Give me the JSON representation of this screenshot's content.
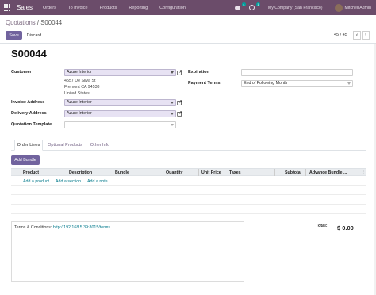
{
  "navbar": {
    "brand": "Sales",
    "menu": [
      "Orders",
      "To Invoice",
      "Products",
      "Reporting",
      "Configuration"
    ],
    "messages_badge": "4",
    "activities_badge": "1",
    "company": "My Company (San Francisco)",
    "user": "Mitchell Admin"
  },
  "breadcrumb": {
    "parent": "Quotations",
    "separator": "/",
    "current": "S00044"
  },
  "buttons": {
    "save": "Save",
    "discard": "Discard",
    "add_bundle": "Add Bundle"
  },
  "pager": {
    "value": "45 / 45",
    "prev": "‹",
    "next": "›"
  },
  "order": {
    "name": "S00044",
    "customer_label": "Customer",
    "customer": "Azure Interior",
    "address": [
      "4557 De Silva St",
      "Fremont CA 94538",
      "United States"
    ],
    "invoice_label": "Invoice Address",
    "invoice_address": "Azure Interior",
    "delivery_label": "Delivery Address",
    "delivery_address": "Azure Interior",
    "template_label": "Quotation Template",
    "template": "",
    "expiration_label": "Expiration",
    "expiration": "",
    "payment_terms_label": "Payment Terms",
    "payment_terms": "End of Following Month"
  },
  "tabs": [
    "Order Lines",
    "Optional Products",
    "Other Info"
  ],
  "table": {
    "columns": [
      "Product",
      "Description",
      "Bundle",
      "Quantity",
      "Unit Price",
      "Taxes",
      "Subtotal",
      "Advance Bundle ..."
    ],
    "add_links": [
      "Add a product",
      "Add a section",
      "Add a note"
    ]
  },
  "footer": {
    "terms_prefix": "Terms & Conditions: ",
    "terms_link": "http://192.168.5.39:8015/terms",
    "total_label": "Total:",
    "total_value": "$ 0.00"
  },
  "colors": {
    "navbar": "#6b4c6a",
    "primary": "#71639e",
    "link": "#00788a"
  }
}
